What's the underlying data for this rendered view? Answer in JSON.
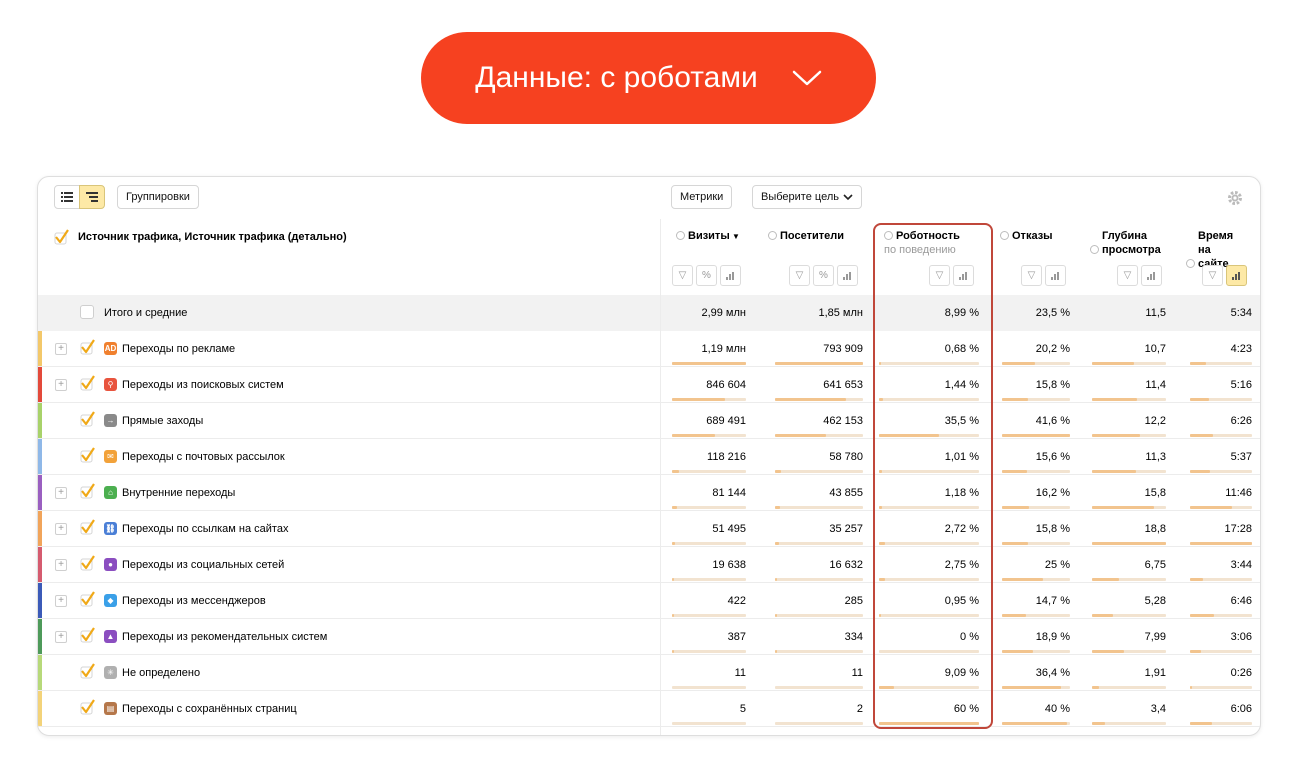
{
  "banner": {
    "label": "Данные: с роботами"
  },
  "toolbar": {
    "groupings": "Группировки",
    "metrics": "Метрики",
    "goal": "Выберите цель"
  },
  "dimension_header": "Источник трафика, Источник трафика (детально)",
  "columns": [
    {
      "title": "Визиты",
      "sort": "▼",
      "sub": "",
      "controls": [
        "filter",
        "percent",
        "chart"
      ]
    },
    {
      "title": "Посетители",
      "sort": "",
      "sub": "",
      "controls": [
        "filter",
        "percent",
        "chart"
      ]
    },
    {
      "title": "Роботность",
      "sort": "",
      "sub": "по поведению",
      "controls": [
        "filter",
        "chart"
      ]
    },
    {
      "title": "Отказы",
      "sort": "",
      "sub": "",
      "controls": [
        "filter",
        "chart"
      ]
    },
    {
      "title": "Глубина просмотра",
      "sort": "",
      "sub": "",
      "controls": [
        "filter",
        "chart"
      ]
    },
    {
      "title": "Время на сайте",
      "sort": "",
      "sub": "",
      "controls": [
        "filter",
        "chart-active"
      ]
    }
  ],
  "total": {
    "label": "Итого и средние",
    "values": [
      "2,99 млн",
      "1,85 млн",
      "8,99 %",
      "23,5 %",
      "11,5",
      "5:34"
    ]
  },
  "rows": [
    {
      "label": "Переходы по рекламе",
      "expandable": true,
      "icon": "ad-icon",
      "icon_text": "AD",
      "icon_color": "#f0802e",
      "strip": "#f3c86a",
      "values": [
        "1,19 млн",
        "793 909",
        "0,68 %",
        "20,2 %",
        "10,7",
        "4:23"
      ],
      "fill": [
        1.0,
        1.0,
        0.02,
        0.49,
        0.57,
        0.26
      ]
    },
    {
      "label": "Переходы из поисковых систем",
      "expandable": true,
      "icon": "search-icon",
      "icon_text": "⚲",
      "icon_color": "#e8543e",
      "strip": "#e3493a",
      "values": [
        "846 604",
        "641 653",
        "1,44 %",
        "15,8 %",
        "11,4",
        "5:16"
      ],
      "fill": [
        0.71,
        0.81,
        0.04,
        0.38,
        0.61,
        0.3
      ]
    },
    {
      "label": "Прямые заходы",
      "expandable": false,
      "icon": "direct-entry-icon",
      "icon_text": "→",
      "icon_color": "#8a8a8a",
      "strip": "#a8d26a",
      "values": [
        "689 491",
        "462 153",
        "35,5 %",
        "41,6 %",
        "12,2",
        "6:26"
      ],
      "fill": [
        0.58,
        0.58,
        0.6,
        1.0,
        0.65,
        0.37
      ]
    },
    {
      "label": "Переходы с почтовых рассылок",
      "expandable": false,
      "icon": "mail-icon",
      "icon_text": "✉",
      "icon_color": "#f2a23a",
      "strip": "#8fb8e8",
      "values": [
        "118 216",
        "58 780",
        "1,01 %",
        "15,6 %",
        "11,3",
        "5:37"
      ],
      "fill": [
        0.1,
        0.07,
        0.03,
        0.37,
        0.6,
        0.32
      ]
    },
    {
      "label": "Внутренние переходы",
      "expandable": true,
      "icon": "home-icon",
      "icon_text": "⌂",
      "icon_color": "#4caf50",
      "strip": "#9a5fc0",
      "values": [
        "81 144",
        "43 855",
        "1,18 %",
        "16,2 %",
        "15,8",
        "11:46"
      ],
      "fill": [
        0.07,
        0.06,
        0.03,
        0.39,
        0.84,
        0.67
      ]
    },
    {
      "label": "Переходы по ссылкам на сайтах",
      "expandable": true,
      "icon": "link-icon",
      "icon_text": "⛓",
      "icon_color": "#4a7fd6",
      "strip": "#f1a45a",
      "values": [
        "51 495",
        "35 257",
        "2,72 %",
        "15,8 %",
        "18,8",
        "17:28"
      ],
      "fill": [
        0.04,
        0.04,
        0.06,
        0.38,
        1.0,
        1.0
      ]
    },
    {
      "label": "Переходы из социальных сетей",
      "expandable": true,
      "icon": "social-icon",
      "icon_text": "●",
      "icon_color": "#8b4ec0",
      "strip": "#d55b6f",
      "values": [
        "19 638",
        "16 632",
        "2,75 %",
        "25 %",
        "6,75",
        "3:44"
      ],
      "fill": [
        0.02,
        0.02,
        0.06,
        0.6,
        0.36,
        0.21
      ]
    },
    {
      "label": "Переходы из мессенджеров",
      "expandable": true,
      "icon": "messenger-icon",
      "icon_text": "◆",
      "icon_color": "#3aa0e8",
      "strip": "#3b5ab8",
      "values": [
        "422",
        "285",
        "0,95 %",
        "14,7 %",
        "5,28",
        "6:46"
      ],
      "fill": [
        0.005,
        0.005,
        0.02,
        0.35,
        0.28,
        0.39
      ]
    },
    {
      "label": "Переходы из рекомендательных систем",
      "expandable": true,
      "icon": "recommend-icon",
      "icon_text": "▲",
      "icon_color": "#8b4ec0",
      "strip": "#4e9a5a",
      "values": [
        "387",
        "334",
        "0 %",
        "18,9 %",
        "7,99",
        "3:06"
      ],
      "fill": [
        0.005,
        0.005,
        0.0,
        0.45,
        0.43,
        0.18
      ]
    },
    {
      "label": "Не определено",
      "expandable": false,
      "icon": "undefined-icon",
      "icon_text": "✳",
      "icon_color": "#b0b0b0",
      "strip": "#b7d97a",
      "values": [
        "11",
        "11",
        "9,09 %",
        "36,4 %",
        "1,91",
        "0:26"
      ],
      "fill": [
        0.0,
        0.0,
        0.15,
        0.87,
        0.1,
        0.03
      ]
    },
    {
      "label": "Переходы с сохранённых страниц",
      "expandable": false,
      "icon": "saved-page-icon",
      "icon_text": "▤",
      "icon_color": "#b5774a",
      "strip": "#f3d37a",
      "values": [
        "5",
        "2",
        "60 %",
        "40 %",
        "3,4",
        "6:06"
      ],
      "fill": [
        0.0,
        0.0,
        1.0,
        0.96,
        0.18,
        0.35
      ]
    }
  ]
}
